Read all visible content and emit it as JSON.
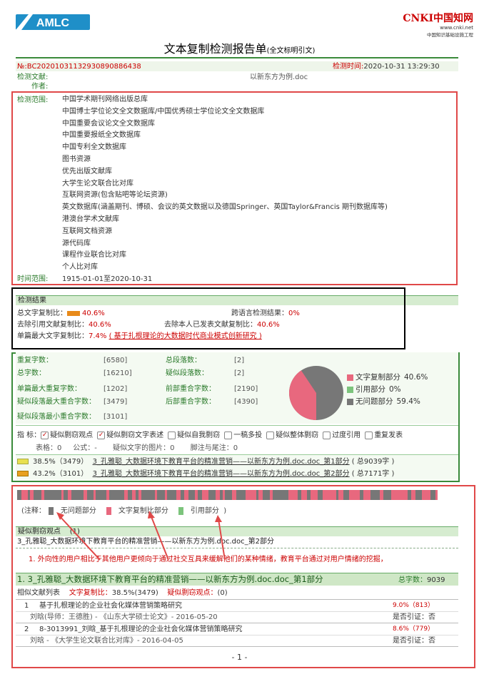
{
  "header": {
    "logo_text": "AMLC",
    "cnki_brand": "CNKI中国知网",
    "cnki_url": "www.cnki.net",
    "cnki_sub": "中国知识基础设施工程",
    "title": "文本复制检测报告单",
    "title_suffix": "(全文标明引文)"
  },
  "meta": {
    "report_id": "№:BC20201031132930890886438",
    "check_time_label": "检测时间:",
    "check_time": "2020-10-31 13:29:30",
    "doc_label": "检测文献:",
    "doc_value": "以新东方为例.doc",
    "author_label": "作者:",
    "scope_label": "检测范围:",
    "time_range_label": "时间范围:",
    "time_range": "1915-01-01至2020-10-31"
  },
  "scope": [
    "中国学术期刊网络出版总库",
    "中国博士学位论文全文数据库/中国优秀硕士学位论文全文数据库",
    "中国重要会议论文全文数据库",
    "中国重要报纸全文数据库",
    "中国专利全文数据库",
    "图书资源",
    "优先出版文献库",
    "大学生论文联合比对库",
    "互联网资源(包含贴吧等论坛资源)",
    "英文数据库(涵盖期刊、博硕、会议的英文数据以及德国Springer、英国Taylor&Francis 期刊数据库等)",
    "港澳台学术文献库",
    "互联网文档资源",
    "源代码库",
    "课程作业联合比对库",
    "个人比对库"
  ],
  "result": {
    "head": "检测结果",
    "total_label": "总文字复制比：",
    "total": "40.6%",
    "cross_label": "跨语言检测结果：",
    "cross": "0%",
    "excl_quote_label": "去除引用文献复制比：",
    "excl_quote": "40.6%",
    "excl_self_label": "去除本人已发表文献复制比：",
    "excl_self": "40.6%",
    "single_max_label": "单篇最大文字复制比：",
    "single_max": "7.4%",
    "single_max_src": "( 基于扎根理论的大数据时代商业模式创新研究 )"
  },
  "stats": {
    "dup_chars_label": "重复字数：",
    "dup_chars": "[6580]",
    "total_paras_label": "总段落数：",
    "total_paras": "[2]",
    "total_chars_label": "总字数：",
    "total_chars": "[16210]",
    "sus_paras_label": "疑似段落数：",
    "sus_paras": "[2]",
    "single_max_dup_label": "单篇最大重复字数：",
    "single_max_dup": "[1202]",
    "front_overlap_label": "前部重合字数：",
    "front_overlap": "[2190]",
    "sus_max_label": "疑似段落最大重合字数：",
    "sus_max": "[3479]",
    "back_overlap_label": "后部重合字数：",
    "back_overlap": "[4390]",
    "sus_min_label": "疑似段落最小重合字数：",
    "sus_min": "[3101]"
  },
  "pie": {
    "legend": [
      {
        "label": "文字复制部分",
        "value": "40.6%",
        "color": "#e8687e"
      },
      {
        "label": "引用部分",
        "value": "0%",
        "color": "#7cc47c"
      },
      {
        "label": "无问题部分",
        "value": "59.4%",
        "color": "#777777"
      }
    ],
    "copy_fraction": 0.406
  },
  "indicators": {
    "label": "指 标：",
    "items": [
      {
        "label": "疑似剽窃观点",
        "checked": true
      },
      {
        "label": "疑似剽窃文字表述",
        "checked": true
      },
      {
        "label": "疑似自我剽窃",
        "checked": false
      },
      {
        "label": "一稿多投",
        "checked": false
      },
      {
        "label": "疑似整体剽窃",
        "checked": false
      },
      {
        "label": "过度引用",
        "checked": false
      },
      {
        "label": "重复发表",
        "checked": false
      }
    ]
  },
  "counts": {
    "tables_label": "表格：",
    "tables": "0",
    "formula_label": "公式：",
    "formula": "-",
    "images_label": "疑似文字的图片：",
    "images": "0",
    "footnote_label": "脚注与尾注：",
    "footnote": "0"
  },
  "parts": [
    {
      "pct": "38.5%（3479）",
      "name": "3_孔雅聪_大数据环境下教育平台的精准营销——以新东方为例.doc.doc_第1部分",
      "total": "( 总9039字 )"
    },
    {
      "pct": "43.2%（3101）",
      "name": "3_孔雅聪_大数据环境下教育平台的精准营销——以新东方为例.doc.doc_第2部分",
      "total": "( 总7171字 )"
    }
  ],
  "bar_legend": {
    "note": "(注释：",
    "ok": "无问题部分",
    "copy": "文字复制比部分",
    "quote": "引用部分",
    "end": ")"
  },
  "viewpoint": {
    "head": "疑似剽窃观点",
    "head_count": "(1)",
    "doc": "3_孔雅聪_大数据环境下教育平台的精准营销——以新东方为例.doc.doc_第2部分",
    "item": "1.  外向性的用户相比于其他用户更倾向于通过社交互具来缓解他们的某种情绪，教育平台通过对用户情绪的挖掘，"
  },
  "section1": {
    "title": "1. 3_孔雅聪_大数据环境下教育平台的精准营销——以新东方为例.doc.doc_第1部分",
    "chars_label": "总字数：",
    "chars": "9039",
    "list_label": "相似文献列表",
    "ratio_label": "文字复制比：",
    "ratio": "38.5%(3479)",
    "plag_label": "疑似剽窃观点：",
    "plag": "(0)"
  },
  "similar": [
    {
      "no": "1",
      "title": "基于扎根理论的企业社会化媒体营销策略研究",
      "pct": "9.0%（813）",
      "source": "刘晗(导师：王德胜) - 《山东大学硕士论文》- 2016-05-20",
      "cite": "是否引证：否"
    },
    {
      "no": "2",
      "title": "8-3013991_刘晗_基于扎根理论的企业社会化媒体营销策略研究",
      "pct": "8.6%（779）",
      "source": "刘晗 - 《大学生论文联合比对库》- 2016-04-05",
      "cite": "是否引证：否"
    }
  ],
  "page_no": "- 1 -",
  "colors": {
    "copy": "#e8687e",
    "ok": "#777777",
    "quote": "#7cc47c",
    "green": "#3a8a3a",
    "red": "#cc0000"
  }
}
